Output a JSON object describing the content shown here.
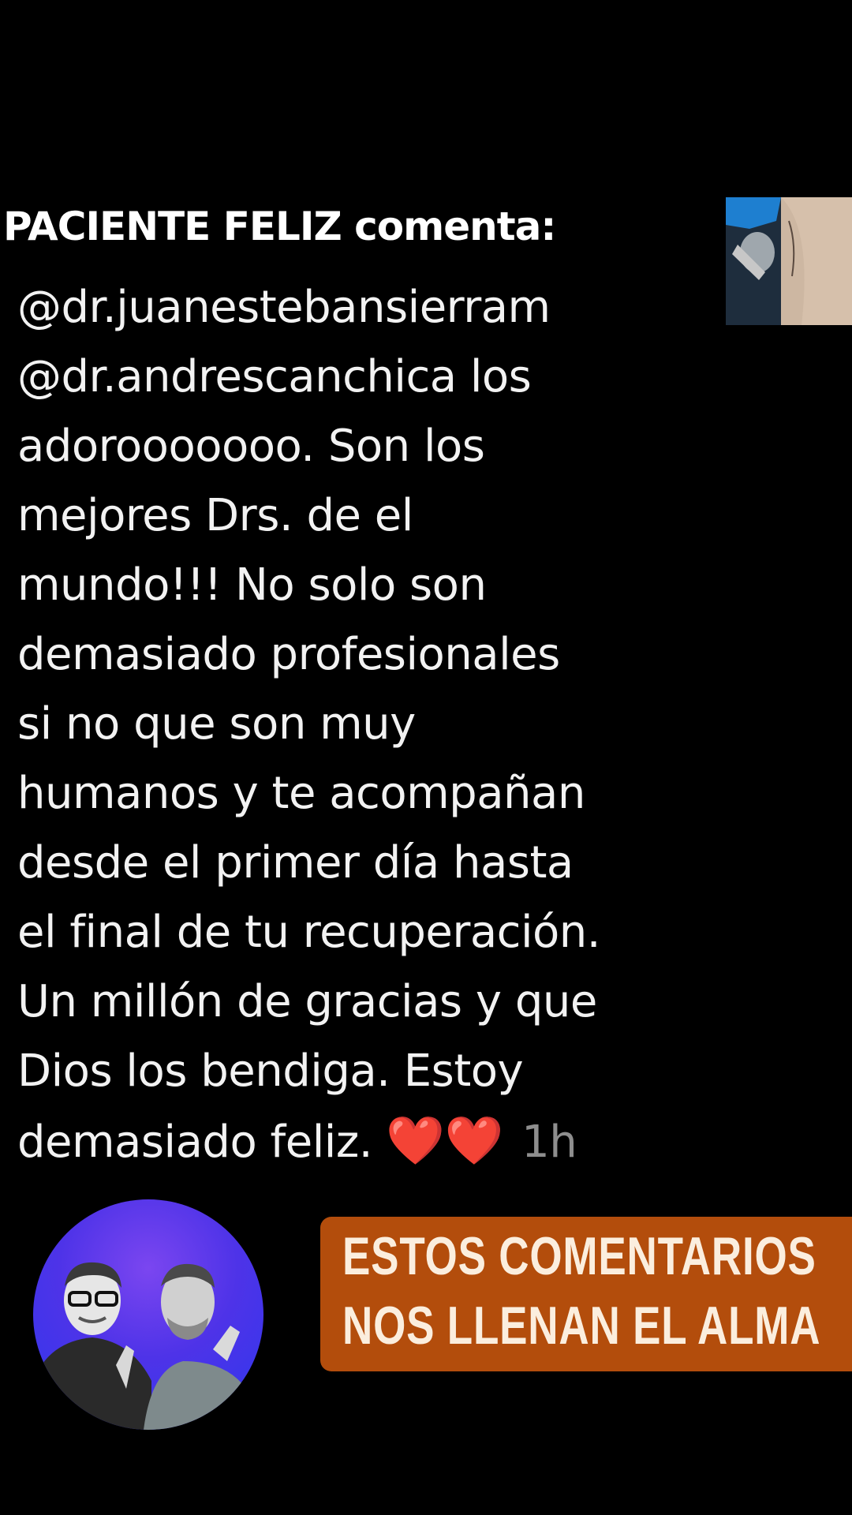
{
  "post": {
    "heading": "PACIENTE FELIZ comenta:",
    "comment_lines": [
      "@dr.juanestebansierram",
      "@dr.andrescanchica los",
      "adorooooooo. Son los",
      "mejores Drs. de el",
      "mundo!!! No solo son",
      "demasiado profesionales",
      "si no que son muy",
      "humanos y te acompañan",
      "desde el primer día hasta",
      "el final de tu recuperación.",
      "Un millón de gracias y que",
      "Dios los bendiga.  Estoy",
      "demasiado feliz."
    ],
    "hearts": "❤️❤️",
    "timestamp": "1h"
  },
  "banner": {
    "line1": "ESTOS COMENTARIOS",
    "line2": "NOS LLENAN EL ALMA"
  },
  "colors": {
    "background": "#000000",
    "banner_bg": "#b34d0c",
    "banner_text": "#fbeede",
    "timestamp": "#8e8e8e",
    "heart": "#e01e25",
    "avatar_gradient": "#4e33e8"
  },
  "icons": {
    "heart": "heart-emoji"
  }
}
